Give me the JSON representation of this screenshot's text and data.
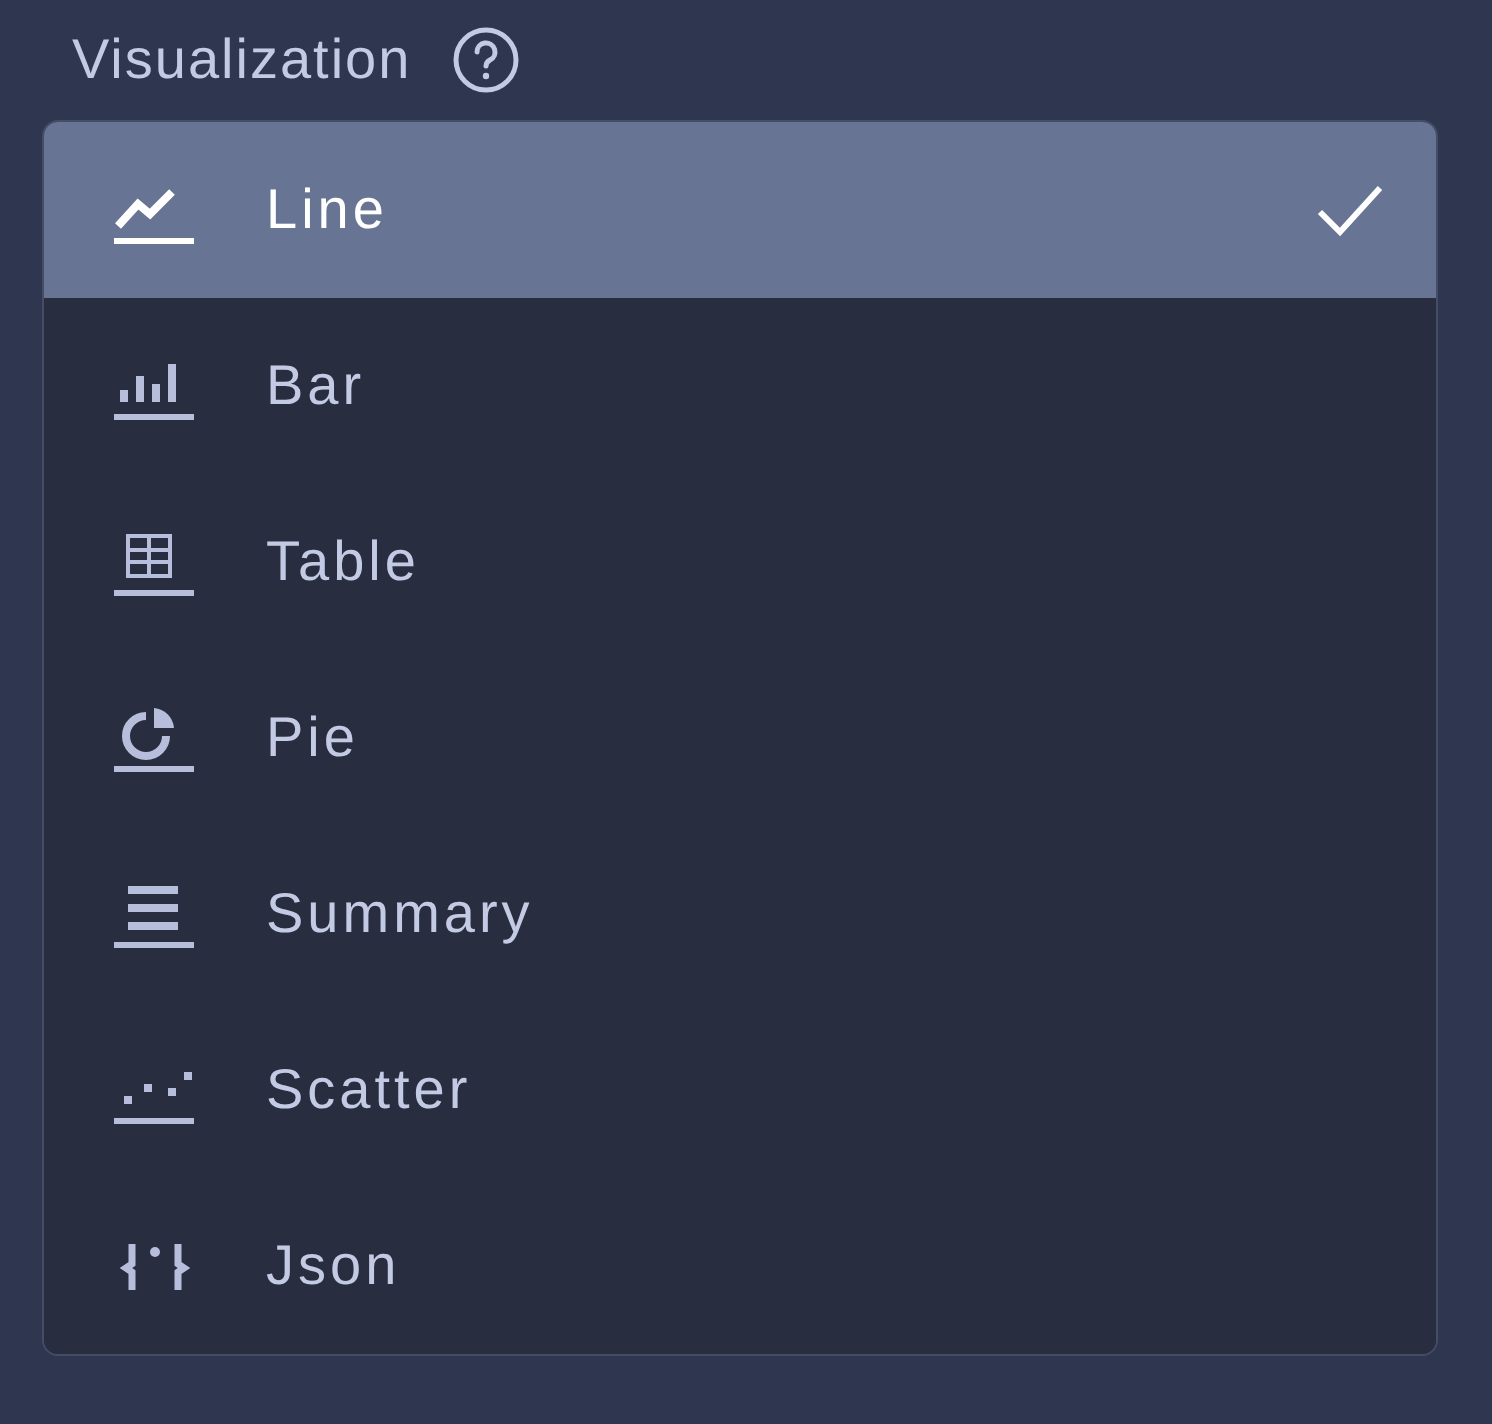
{
  "label": "Visualization",
  "options": [
    {
      "kind": "line",
      "label": "Line",
      "selected": true
    },
    {
      "kind": "bar",
      "label": "Bar",
      "selected": false
    },
    {
      "kind": "table",
      "label": "Table",
      "selected": false
    },
    {
      "kind": "pie",
      "label": "Pie",
      "selected": false
    },
    {
      "kind": "summary",
      "label": "Summary",
      "selected": false
    },
    {
      "kind": "scatter",
      "label": "Scatter",
      "selected": false
    },
    {
      "kind": "json",
      "label": "Json",
      "selected": false
    }
  ]
}
